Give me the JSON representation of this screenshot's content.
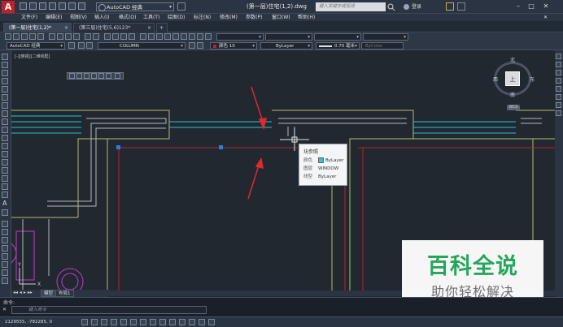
{
  "app": {
    "logo_letter": "A",
    "workspace": "AutoCAD 经典",
    "document_title": "(第一层)住宅(1,2).dwg",
    "search_placeholder": "键入关键字或短语",
    "login_label": "登录"
  },
  "menu": [
    "文件(F)",
    "编辑(E)",
    "视图(V)",
    "插入(I)",
    "格式(O)",
    "工具(T)",
    "绘图(D)",
    "标注(N)",
    "修改(M)",
    "参数(P)",
    "窗口(W)",
    "帮助(H)"
  ],
  "tabs": [
    {
      "label": "(第一层)住宅(1,2)*",
      "active": true
    },
    {
      "label": "(第三层)住宅(5,6)123*",
      "active": false
    }
  ],
  "toolbar": {
    "workspace_combo": "AutoCAD 经典",
    "layer_combo": "COLUMN",
    "color_combo": "颜色 10",
    "linetype_combo": "ByLayer",
    "lineweight_combo": "0.70 毫米",
    "plotstyle_combo": "ByColor"
  },
  "viewport_label": "[-][俯视][二维线框]",
  "navcube": {
    "north": "北",
    "south": "南",
    "east": "东",
    "west": "西",
    "top": "上",
    "wcs": "WCS"
  },
  "tooltip": {
    "title": "块参照",
    "rows": [
      {
        "key": "颜色",
        "value": "ByLayer",
        "swatch_color": "#25c6d6"
      },
      {
        "key": "图层",
        "value": "WINDOW"
      },
      {
        "key": "线型",
        "value": "ByLayer"
      }
    ]
  },
  "layout_tabs": [
    "模型",
    "布局1"
  ],
  "command": {
    "label": "命令:",
    "placeholder": "键入命令"
  },
  "status": {
    "coordinates": "2129555, -782285, 0"
  },
  "watermark": {
    "title": "百科全说",
    "subtitle": "助你轻松解决"
  },
  "colors": {
    "background": "#212830",
    "selection_red": "#c0202a",
    "annotation_arrow": "#e02a2a",
    "wall": "#b5b7ba",
    "window": "#25c6d6",
    "column": "#c8cc7a",
    "grip": "#2a7de1"
  }
}
